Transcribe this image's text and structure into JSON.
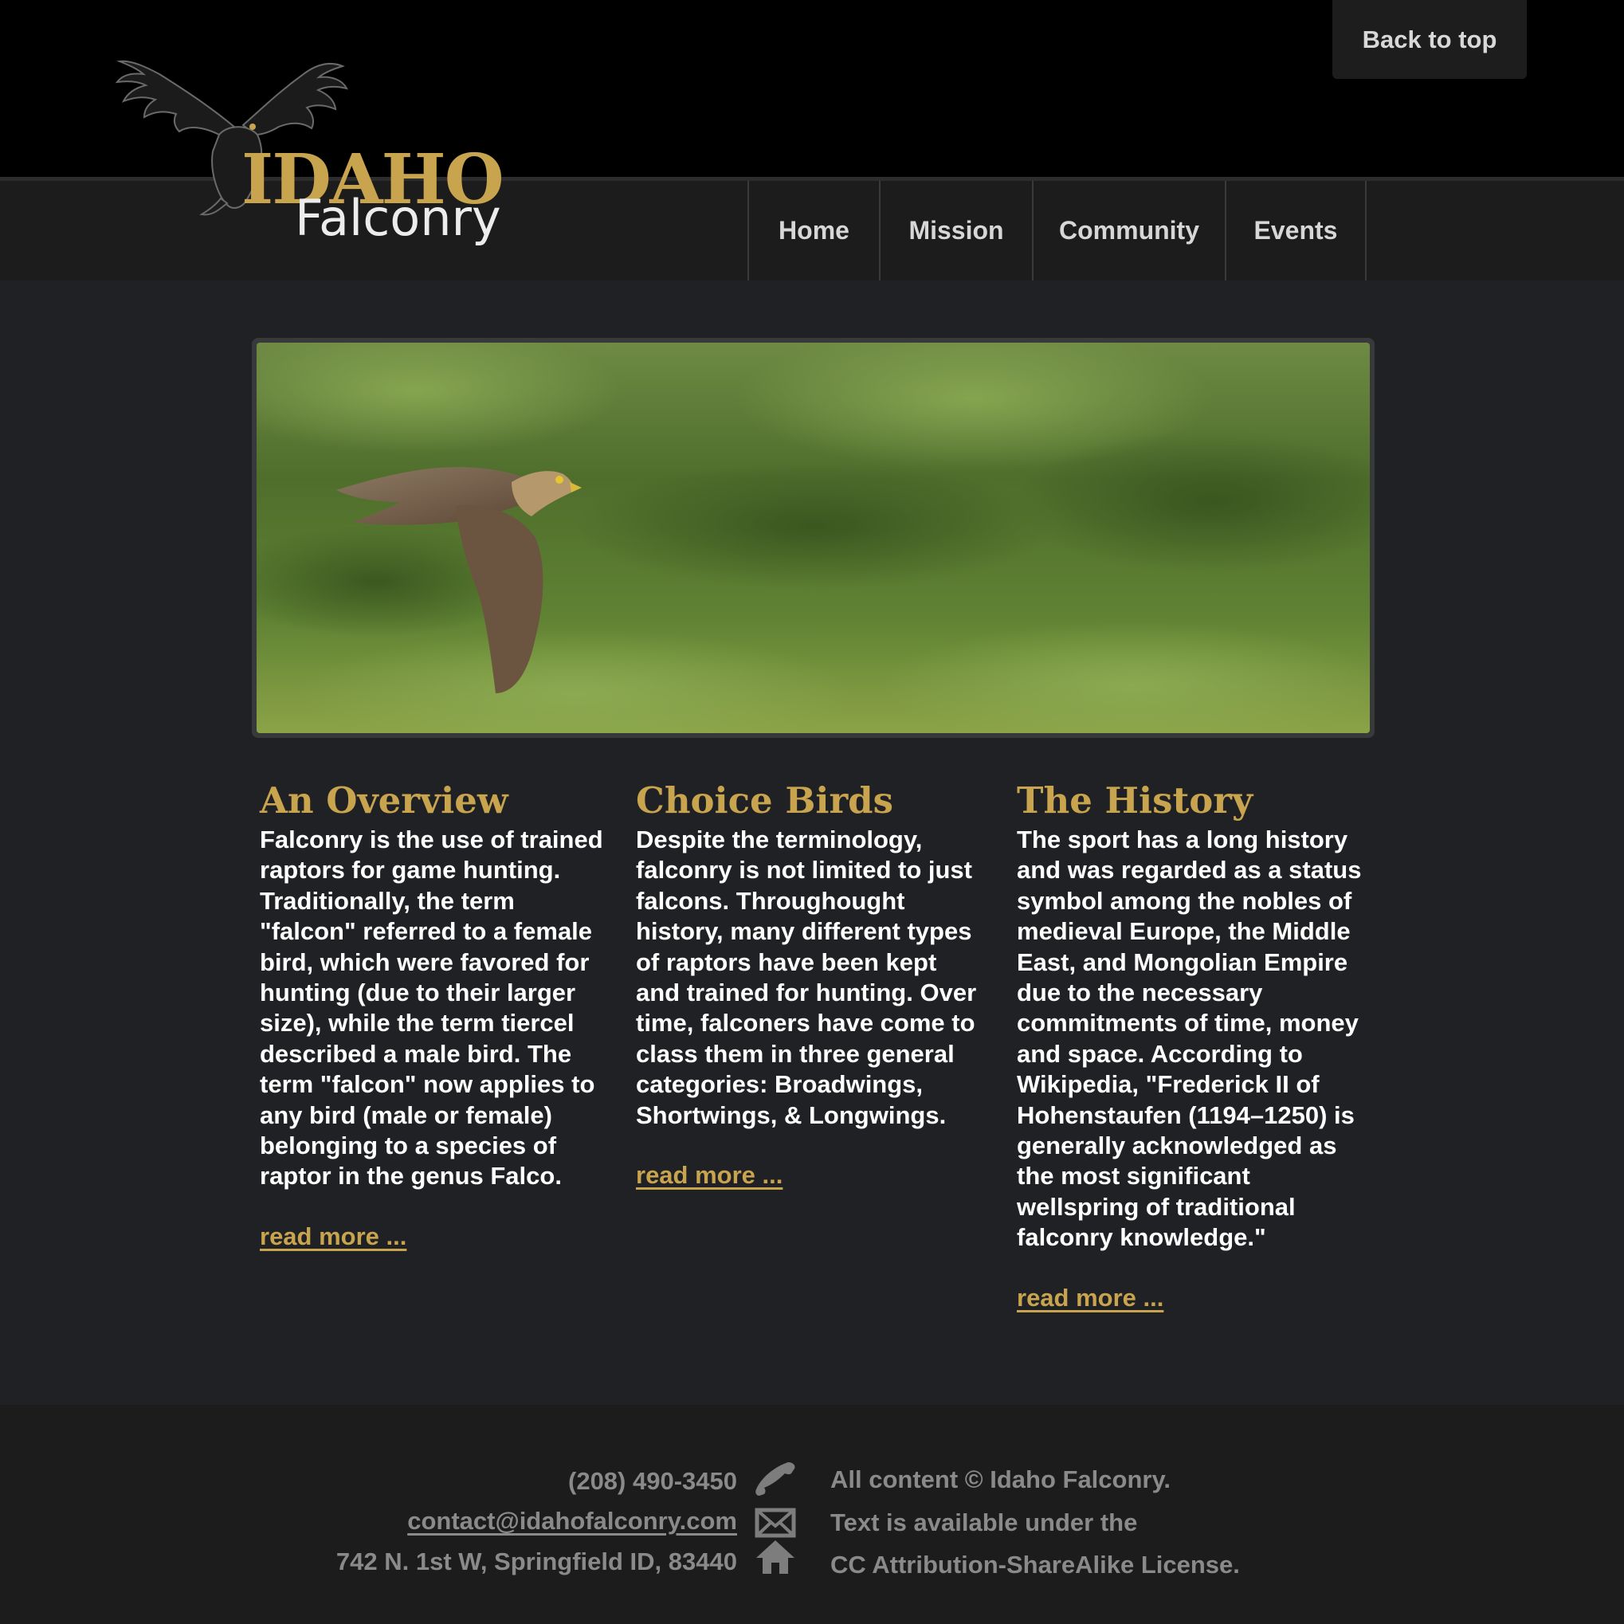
{
  "header": {
    "back_to_top": "Back to top",
    "logo": {
      "line1": "IDAHO",
      "line2": "Falconry"
    }
  },
  "nav": {
    "items": [
      {
        "label": "Home"
      },
      {
        "label": "Mission"
      },
      {
        "label": "Community"
      },
      {
        "label": "Events"
      }
    ]
  },
  "hero": {
    "description": "falcon in flight over green bushes"
  },
  "sections": [
    {
      "title": "An Overview",
      "body": "Falconry is the use of trained raptors for game hunting. Traditionally, the term \"falcon\" referred to a female bird, which were favored for hunting (due to their larger size), while the term tiercel described a male bird. The term \"falcon\" now applies to any bird (male or female) belonging to a species of raptor in the genus Falco.",
      "link": "read more ..."
    },
    {
      "title": "Choice Birds",
      "body": "Despite the terminology, falconry is not limited to just falcons. Throughought history, many different types of raptors have been kept and trained for hunting. Over time, falconers have come to class them in three general categories: Broadwings, Shortwings, & Longwings.",
      "link": "read more ..."
    },
    {
      "title": "The History",
      "body": "The sport has a long history and was regarded as a status symbol among the nobles of medieval Europe, the Middle East, and Mongolian Empire due to the necessary commitments of time, money and space. According to Wikipedia, \"Frederick II of Hohenstaufen (1194–1250) is generally acknowledged as the most significant wellspring of traditional falconry knowledge.\"",
      "link": "read more ..."
    }
  ],
  "footer": {
    "phone": "(208) 490-3450",
    "email": "contact@idahofalconry.com",
    "address": "742 N. 1st W, Springfield ID, 83440",
    "license_line1": "All content © Idaho Falconry.",
    "license_line2": "Text is available under the",
    "license_line3": "CC Attribution-ShareAlike License.",
    "icons": [
      "phone-icon",
      "envelope-icon",
      "home-icon"
    ]
  },
  "colors": {
    "accent": "#c9a44e",
    "background": "#202124",
    "header": "#000000",
    "footer_text": "#8a8a8a"
  }
}
